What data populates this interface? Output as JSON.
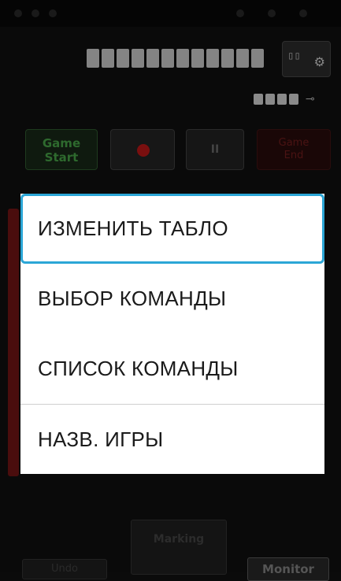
{
  "controls": {
    "game_start_label": "Game\nStart",
    "pause_label": "II",
    "game_end_label": "Game\nEnd"
  },
  "bottom": {
    "undo_label": "Undo",
    "marking_label": "Marking",
    "monitor_label": "Monitor"
  },
  "menu": {
    "items": [
      {
        "label": "ИЗМЕНИТЬ ТАБЛО",
        "highlighted": true
      },
      {
        "label": "ВЫБОР КОМАНДЫ"
      },
      {
        "label": "СПИСОК КОМАНДЫ"
      },
      {
        "label": "НАЗВ. ИГРЫ"
      }
    ]
  },
  "colors": {
    "menu_highlight": "#2ba6d6",
    "background": "#0a0a0a",
    "menu_bg": "#ffffff"
  },
  "icons": {
    "settings": "gear-icon",
    "record": "record-dot-icon",
    "power": "plug-icon"
  }
}
